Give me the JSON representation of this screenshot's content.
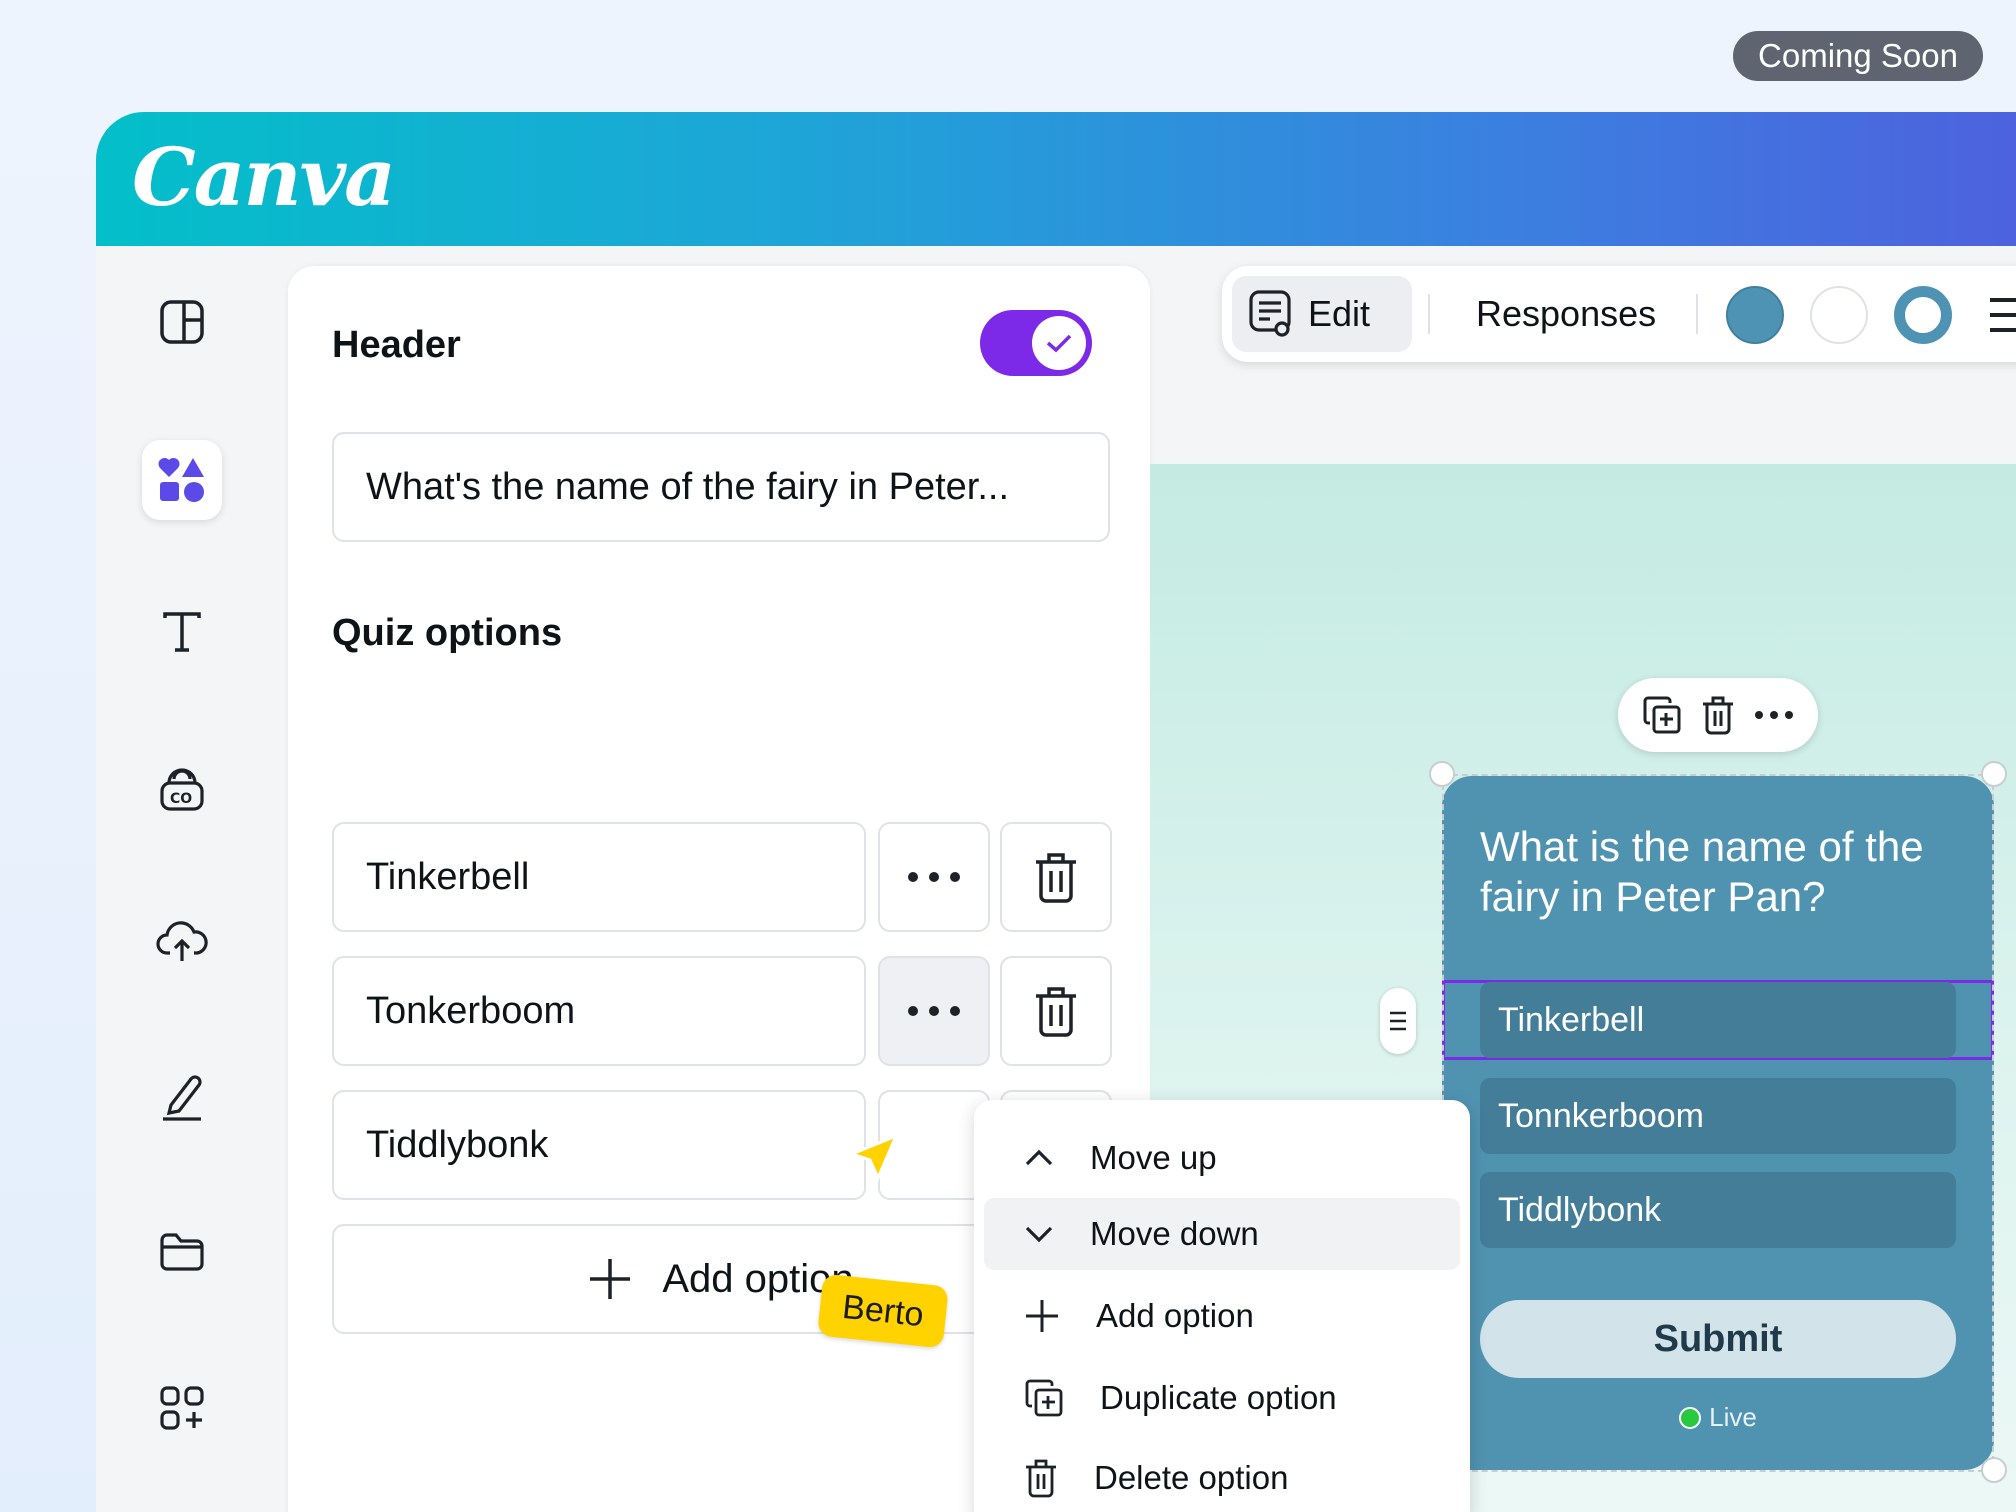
{
  "badge": {
    "coming_soon": "Coming Soon"
  },
  "brand": {
    "logo_text": "Canva",
    "accent": "#7d2ae8"
  },
  "sidebar": {
    "items": [
      {
        "icon": "layout-icon"
      },
      {
        "icon": "elements-icon",
        "active": true
      },
      {
        "icon": "text-icon"
      },
      {
        "icon": "brand-icon"
      },
      {
        "icon": "upload-icon"
      },
      {
        "icon": "draw-icon"
      },
      {
        "icon": "folder-icon"
      },
      {
        "icon": "apps-icon"
      }
    ]
  },
  "panel": {
    "header_label": "Header",
    "header_toggle_on": true,
    "header_value": "What's the name of the fairy in Peter...",
    "quiz_options_label": "Quiz options",
    "options": [
      "Tinkerbell",
      "Tonkerboom",
      "Tiddlybonk"
    ],
    "add_option_label": "Add option"
  },
  "toolbar": {
    "edit_label": "Edit",
    "responses_label": "Responses",
    "swatches": [
      "#4f93b4",
      "#ffffff",
      "#4f93b4"
    ]
  },
  "card": {
    "question": "What is the name of the fairy in Peter Pan?",
    "options": [
      "Tinkerbell",
      "Tonnkerboom",
      "Tiddlybonk"
    ],
    "submit_label": "Submit",
    "status": "Live",
    "bg_color": "#5093b1"
  },
  "menu": {
    "items": [
      {
        "label": "Move up",
        "icon": "chevron-up-icon"
      },
      {
        "label": "Move down",
        "icon": "chevron-down-icon"
      },
      {
        "label": "Add option",
        "icon": "plus-icon"
      },
      {
        "label": "Duplicate option",
        "icon": "duplicate-icon"
      },
      {
        "label": "Delete option",
        "icon": "trash-icon"
      }
    ]
  },
  "collaborator": {
    "name": "Berto",
    "color": "#ffd200"
  }
}
